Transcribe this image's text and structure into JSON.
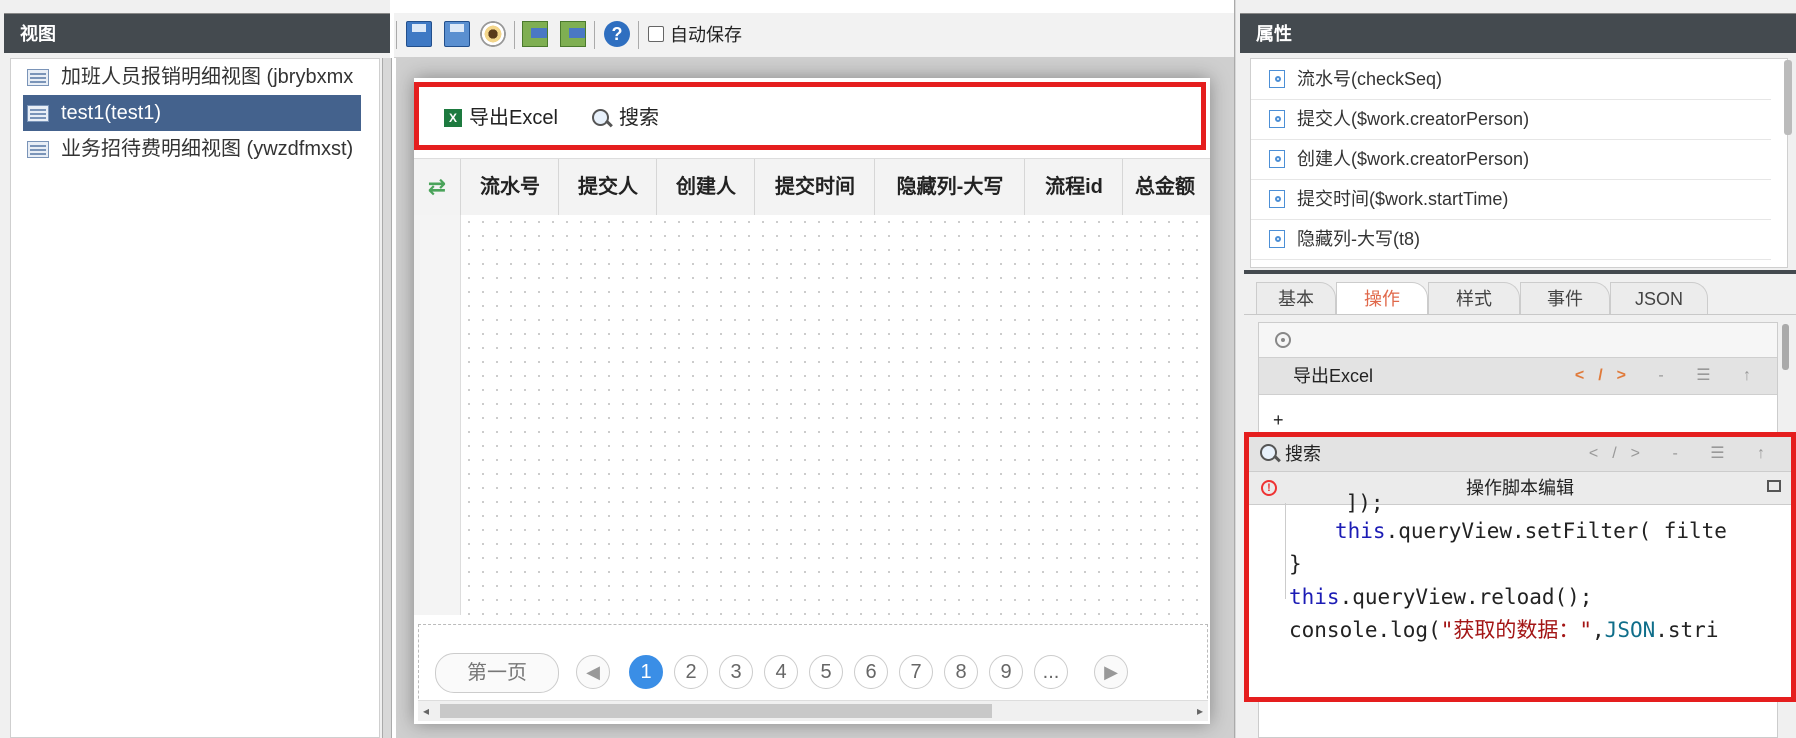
{
  "left_panel": {
    "title": "视图",
    "items": [
      {
        "label": "加班人员报销明细视图 (jbrybxmx",
        "selected": false
      },
      {
        "label": "test1(test1)",
        "selected": true
      },
      {
        "label": "业务招待费明细视图 (ywzdfmxst)",
        "selected": false
      }
    ]
  },
  "toolbar": {
    "buttons": [
      "save-icon",
      "save-as-icon",
      "preview-icon",
      "import-icon",
      "export-icon",
      "help-icon"
    ],
    "help_glyph": "?",
    "autosave_label": "自动保存",
    "autosave_checked": false
  },
  "designer": {
    "actions": [
      {
        "label": "导出Excel",
        "icon": "excel-icon",
        "icon_glyph": "X"
      },
      {
        "label": "搜索",
        "icon": "search-icon"
      }
    ],
    "refresh_glyph": "⇄",
    "columns": [
      "流水号",
      "提交人",
      "创建人",
      "提交时间",
      "隐藏列-大写",
      "流程id",
      "总金额"
    ],
    "pager": {
      "first_label": "第一页",
      "prev_glyph": "◀",
      "next_glyph": "▶",
      "pages": [
        "1",
        "2",
        "3",
        "4",
        "5",
        "6",
        "7",
        "8",
        "9",
        "..."
      ],
      "current": "1"
    }
  },
  "right_panel": {
    "title": "属性",
    "fields": [
      "流水号(checkSeq)",
      "提交人($work.creatorPerson)",
      "创建人($work.creatorPerson)",
      "提交时间($work.startTime)",
      "隐藏列-大写(t8)"
    ],
    "tabs": [
      {
        "label": "基本",
        "active": false
      },
      {
        "label": "操作",
        "active": true
      },
      {
        "label": "样式",
        "active": false
      },
      {
        "label": "事件",
        "active": false
      },
      {
        "label": "JSON",
        "active": false
      }
    ],
    "ops": {
      "export_label": "导出Excel",
      "add_label": "+",
      "search_label": "搜索",
      "row_actions": "</> - ☰ ↑",
      "editor_title": "操作脚本编辑",
      "warn_glyph": "!",
      "code": {
        "line0": "    ]);",
        "line1_kw": "this",
        "line1_rest": ".queryView.setFilter( filte",
        "line2": "}",
        "line3_kw": "this",
        "line3_rest": ".queryView.reload();",
        "line4_a": "console.log(",
        "line4_str": "\"获取的数据：\"",
        "line4_b": ",",
        "line4_obj": "JSON",
        "line4_c": ".stri"
      }
    }
  },
  "colors": {
    "header_bg": "#444a4f",
    "selected_item": "#44628d",
    "highlight_red": "#e51e1e",
    "active_tab": "#e0684a",
    "page_active": "#3a8ee6"
  }
}
